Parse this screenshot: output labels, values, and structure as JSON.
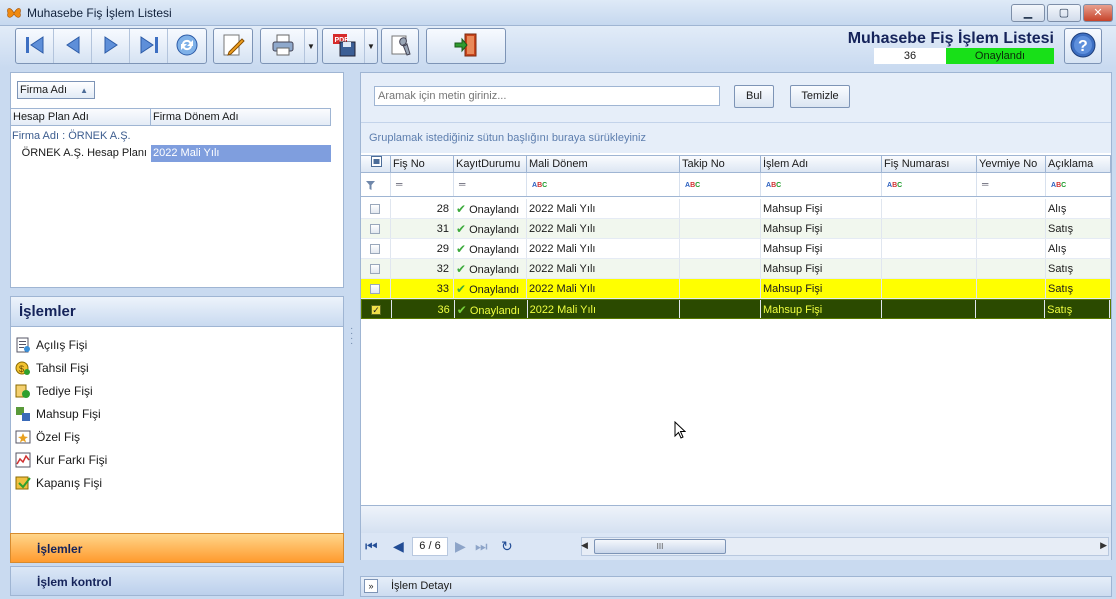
{
  "window": {
    "title": "Muhasebe Fiş İşlem Listesi",
    "controls": {
      "minimize": "▁",
      "maximize": "▢",
      "close": "✕"
    }
  },
  "toolbar": {
    "buttons": [
      {
        "name": "first-record-button",
        "icon": "first-record-icon"
      },
      {
        "name": "previous-record-button",
        "icon": "previous-record-icon"
      },
      {
        "name": "next-record-button",
        "icon": "next-record-icon"
      },
      {
        "name": "last-record-button",
        "icon": "last-record-icon"
      },
      {
        "name": "refresh-button",
        "icon": "refresh-icon"
      },
      {
        "name": "edit-button",
        "icon": "edit-pencil-icon"
      },
      {
        "name": "print-button",
        "icon": "printer-icon"
      },
      {
        "name": "export-pdf-button",
        "icon": "pdf-save-icon"
      },
      {
        "name": "settings-button",
        "icon": "wrench-icon"
      },
      {
        "name": "exit-button",
        "icon": "exit-door-icon"
      }
    ]
  },
  "header": {
    "title": "Muhasebe Fiş İşlem Listesi",
    "record_no": "36",
    "status": "Onaylandı",
    "status_color": "#18e018"
  },
  "left_top": {
    "group_chip": "Firma Adı",
    "columns": [
      "Hesap Plan Adı",
      "Firma Dönem Adı"
    ],
    "group_row": "Firma Adı : ÖRNEK A.Ş.",
    "row": {
      "hesap_plan": "ÖRNEK A.Ş. Hesap Planı",
      "donem": "2022 Mali Yılı"
    }
  },
  "islemler": {
    "title": "İşlemler",
    "items": [
      {
        "label": "Açılış Fişi",
        "icon": "opening-voucher-icon"
      },
      {
        "label": "Tahsil Fişi",
        "icon": "collection-voucher-icon"
      },
      {
        "label": "Tediye Fişi",
        "icon": "payment-voucher-icon"
      },
      {
        "label": "Mahsup Fişi",
        "icon": "offset-voucher-icon"
      },
      {
        "label": "Özel Fiş",
        "icon": "special-voucher-icon"
      },
      {
        "label": "Kur Farkı Fişi",
        "icon": "exchange-difference-icon"
      },
      {
        "label": "Kapanış Fişi",
        "icon": "closing-voucher-icon"
      }
    ]
  },
  "nav_tabs": {
    "active": "İşlemler",
    "inactive": "İşlem kontrol"
  },
  "search": {
    "placeholder": "Aramak için metin giriniz...",
    "find_label": "Bul",
    "clear_label": "Temizle",
    "group_hint": "Gruplamak istediğiniz sütun başlığını buraya sürükleyiniz"
  },
  "grid": {
    "columns": [
      "Fiş No",
      "KayıtDurumu",
      "Mali Dönem",
      "Takip No",
      "İşlem Adı",
      "Fiş Numarası",
      "Yevmiye No",
      "Açıklama"
    ],
    "filter_equals": "═",
    "rows": [
      {
        "fis_no": "28",
        "durum": "Onaylandı",
        "donem": "2022 Mali Yılı",
        "takip": "",
        "islem": "Mahsup Fişi",
        "fis_numara": "",
        "yevmiye": "",
        "aciklama": "Alış",
        "checked": false
      },
      {
        "fis_no": "31",
        "durum": "Onaylandı",
        "donem": "2022 Mali Yılı",
        "takip": "",
        "islem": "Mahsup Fişi",
        "fis_numara": "",
        "yevmiye": "",
        "aciklama": "Satış",
        "checked": false
      },
      {
        "fis_no": "29",
        "durum": "Onaylandı",
        "donem": "2022 Mali Yılı",
        "takip": "",
        "islem": "Mahsup Fişi",
        "fis_numara": "",
        "yevmiye": "",
        "aciklama": "Alış",
        "checked": false
      },
      {
        "fis_no": "32",
        "durum": "Onaylandı",
        "donem": "2022 Mali Yılı",
        "takip": "",
        "islem": "Mahsup Fişi",
        "fis_numara": "",
        "yevmiye": "",
        "aciklama": "Satış",
        "checked": false
      },
      {
        "fis_no": "33",
        "durum": "Onaylandı",
        "donem": "2022 Mali Yılı",
        "takip": "",
        "islem": "Mahsup Fişi",
        "fis_numara": "",
        "yevmiye": "",
        "aciklama": "Satış",
        "checked": false
      },
      {
        "fis_no": "36",
        "durum": "Onaylandı",
        "donem": "2022 Mali Yılı",
        "takip": "",
        "islem": "Mahsup Fişi",
        "fis_numara": "",
        "yevmiye": "",
        "aciklama": "Satış",
        "checked": true
      }
    ],
    "colors": {
      "highlight": "#ffff00",
      "selected": "#2b4a00"
    }
  },
  "pager": {
    "text": "6 / 6",
    "scroll_grip": "III"
  },
  "detail": {
    "label": "İşlem Detayı"
  }
}
